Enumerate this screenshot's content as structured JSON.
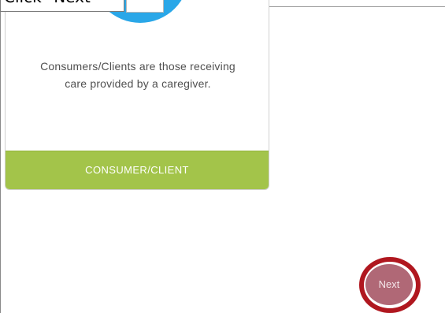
{
  "instruction": {
    "text": "Click \"Next\""
  },
  "card": {
    "description": "Consumers/Clients are those receiving care provided by a caregiver.",
    "button_label": "CONSUMER/CLIENT",
    "icon": "consumer-icon",
    "accent_color": "#2aa7e8",
    "button_color": "#a3c44a"
  },
  "next_button": {
    "label": "Next",
    "color": "#b06876",
    "highlight_color": "#b0171f"
  }
}
